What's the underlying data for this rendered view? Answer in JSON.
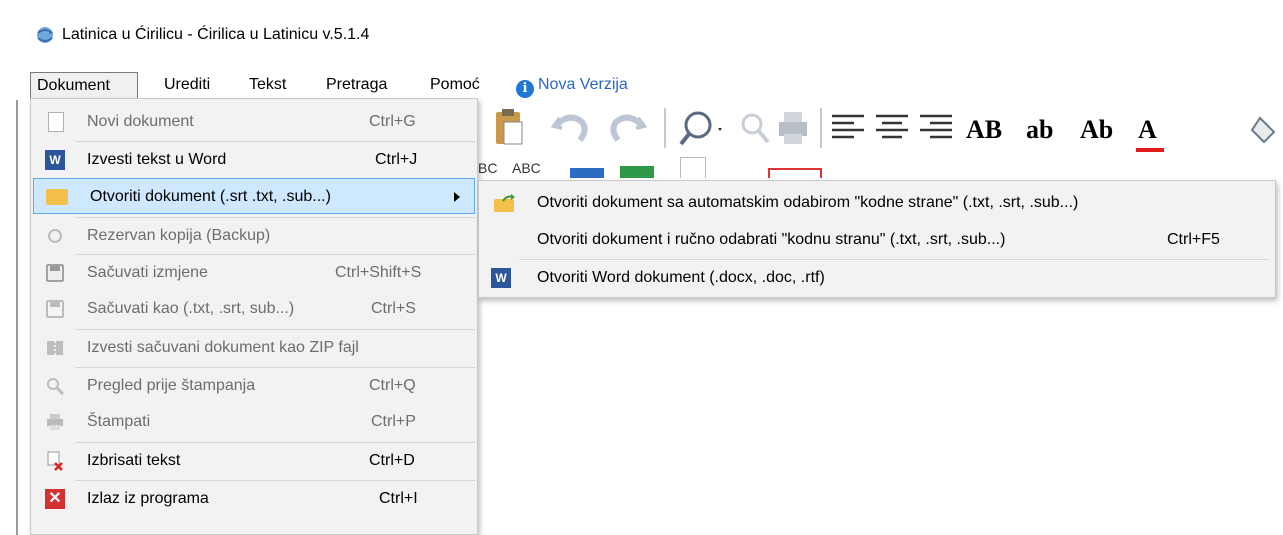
{
  "window": {
    "title": "Latinica u Ćirilicu - Ćirilica u Latinicu v.5.1.4",
    "icon": "globe-arrows-icon"
  },
  "menubar": {
    "items": [
      {
        "label": "Dokument"
      },
      {
        "label": "Urediti"
      },
      {
        "label": "Tekst"
      },
      {
        "label": "Pretraga"
      },
      {
        "label": "Pomoć"
      }
    ],
    "nova_verzija": "Nova Verzija",
    "info_icon": "i"
  },
  "toolbar": {
    "text_buttons": [
      "AB",
      "ab",
      "Ab",
      "A"
    ],
    "row2_labels": [
      "BC",
      "ABC"
    ],
    "accent_red": "#e01e1e"
  },
  "dropdown": {
    "items": [
      {
        "label": "Novi dokument",
        "shortcut": "Ctrl+G",
        "icon": "new-document-icon",
        "enabled": false
      },
      {
        "label": "Izvesti tekst u Word",
        "shortcut": "Ctrl+J",
        "icon": "word-icon",
        "enabled": true
      },
      {
        "label": "Otvoriti dokument (.srt  .txt, .sub...)",
        "shortcut": "",
        "icon": "folder-open-icon",
        "enabled": true,
        "highlighted": true,
        "submenu": true
      },
      {
        "label": "Rezervan kopija (Backup)",
        "shortcut": "",
        "icon": "backup-icon",
        "enabled": false
      },
      {
        "label": "Sačuvati izmjene",
        "shortcut": "Ctrl+Shift+S",
        "icon": "save-icon",
        "enabled": false
      },
      {
        "label": "Sačuvati kao (.txt, .srt, sub...)",
        "shortcut": "Ctrl+S",
        "icon": "save-as-icon",
        "enabled": false
      },
      {
        "label": "Izvesti sačuvani dokument kao ZIP fajl",
        "shortcut": "",
        "icon": "zip-icon",
        "enabled": false
      },
      {
        "label": "Pregled prije štampanja",
        "shortcut": "Ctrl+Q",
        "icon": "print-preview-icon",
        "enabled": false
      },
      {
        "label": "Štampati",
        "shortcut": "Ctrl+P",
        "icon": "printer-icon",
        "enabled": false
      },
      {
        "label": "Izbrisati tekst",
        "shortcut": "Ctrl+D",
        "icon": "delete-text-icon",
        "enabled": true
      },
      {
        "label": "Izlaz iz programa",
        "shortcut": "Ctrl+I",
        "icon": "exit-icon",
        "enabled": true
      }
    ]
  },
  "submenu": {
    "items": [
      {
        "label": "Otvoriti dokument sa automatskim odabirom \"kodne strane\"  (.txt, .srt, .sub...)",
        "shortcut": "",
        "icon": "folder-arrow-icon"
      },
      {
        "label": "Otvoriti dokument i ručno odabrati \"kodnu stranu\" (.txt, .srt, .sub...)",
        "shortcut": "Ctrl+F5",
        "icon": ""
      },
      {
        "label": "Otvoriti Word dokument (.docx, .doc, .rtf)",
        "shortcut": "",
        "icon": "word-icon"
      }
    ]
  }
}
